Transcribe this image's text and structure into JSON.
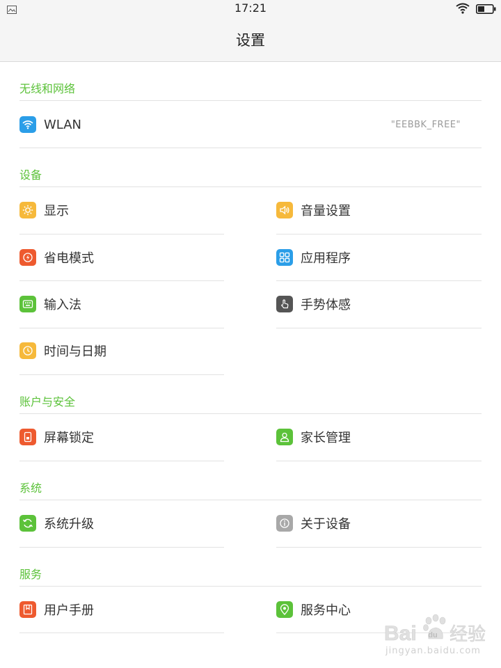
{
  "status_bar": {
    "time": "17:21",
    "icons": [
      "image-icon",
      "wifi-icon",
      "battery-icon"
    ]
  },
  "header": {
    "title": "设置"
  },
  "sections": [
    {
      "label": "无线和网络",
      "items": [
        {
          "label": "WLAN",
          "value": "\"EEBBK_FREE\"",
          "icon": "wifi-icon",
          "color": "#2b9ee8"
        }
      ]
    },
    {
      "label": "设备",
      "items": [
        {
          "label": "显示",
          "icon": "brightness-icon",
          "color": "#f6b93b"
        },
        {
          "label": "音量设置",
          "icon": "volume-icon",
          "color": "#f6b93b"
        },
        {
          "label": "省电模式",
          "icon": "power-saving-icon",
          "color": "#ee5a2f"
        },
        {
          "label": "应用程序",
          "icon": "apps-icon",
          "color": "#2b9ee8"
        },
        {
          "label": "输入法",
          "icon": "keyboard-icon",
          "color": "#5cc23a"
        },
        {
          "label": "手势体感",
          "icon": "gesture-icon",
          "color": "#555555"
        },
        {
          "label": "时间与日期",
          "icon": "clock-icon",
          "color": "#f6b93b"
        }
      ]
    },
    {
      "label": "账户与安全",
      "items": [
        {
          "label": "屏幕锁定",
          "icon": "screen-lock-icon",
          "color": "#ee5a2f"
        },
        {
          "label": "家长管理",
          "icon": "parent-icon",
          "color": "#5cc23a"
        }
      ]
    },
    {
      "label": "系统",
      "items": [
        {
          "label": "系统升级",
          "icon": "update-icon",
          "color": "#5cc23a"
        },
        {
          "label": "关于设备",
          "icon": "info-icon",
          "color": "#a8a8a8"
        }
      ]
    },
    {
      "label": "服务",
      "items": [
        {
          "label": "用户手册",
          "icon": "manual-icon",
          "color": "#ee5a2f"
        },
        {
          "label": "服务中心",
          "icon": "location-icon",
          "color": "#5cc23a"
        }
      ]
    }
  ],
  "watermark": {
    "logo_text": "Bai du 经验",
    "url_text": "jingyan.baidu.com"
  },
  "colors": {
    "accent": "#5cc23a",
    "divider": "#e2e2e2",
    "header_bg": "#f5f5f5"
  }
}
